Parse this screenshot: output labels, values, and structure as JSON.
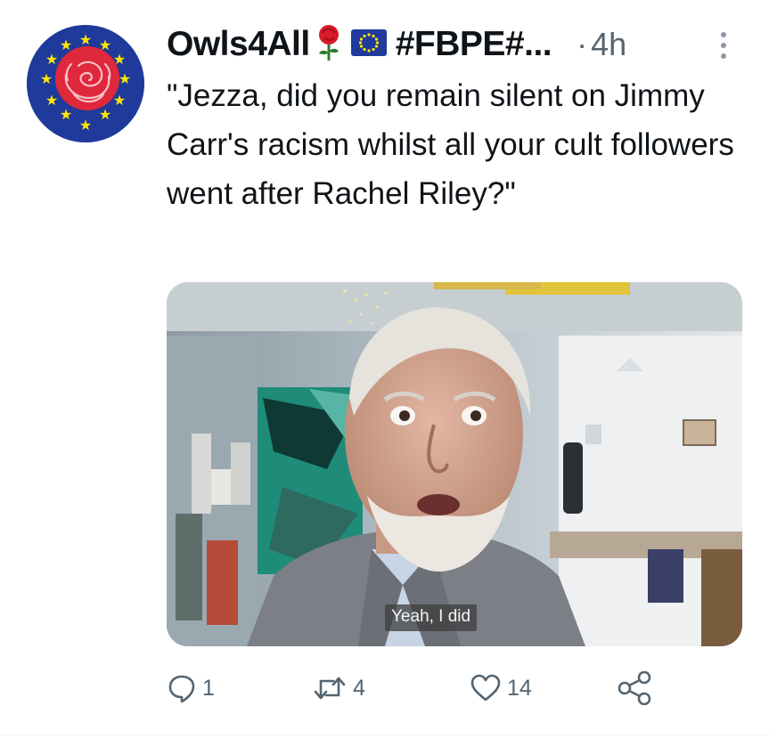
{
  "tweet": {
    "display_name": "Owls4All",
    "hashtag": "#FBPE#...",
    "separator": "·",
    "time": "4h",
    "text": "\"Jezza, did you remain silent on Jimmy Carr's racism whilst all your cult followers went after Rachel Riley?\"",
    "media": {
      "subtitle": "Yeah, I did"
    },
    "actions": {
      "replies": "1",
      "retweets": "4",
      "likes": "14"
    }
  },
  "icons": {
    "avatar": "eu-flag-rose-avatar",
    "rose": "rose-emoji",
    "eu_flag": "eu-flag-emoji",
    "more": "more-vertical-icon",
    "reply": "reply-icon",
    "retweet": "retweet-icon",
    "like": "heart-icon",
    "share": "share-icon"
  },
  "colors": {
    "text": "#0f1419",
    "secondary": "#536471",
    "eu_blue": "#1f3a9a",
    "eu_star": "#ffe600",
    "rose_red": "#e0283c"
  }
}
